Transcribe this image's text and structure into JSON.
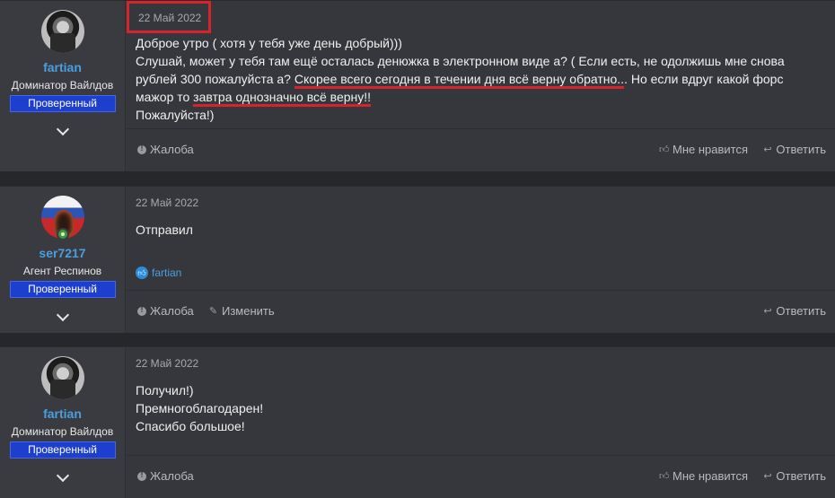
{
  "posts": [
    {
      "username": "fartian",
      "user_title": "Доминатор Вайлдов",
      "badge": "Проверенный",
      "avatar": "bw-portrait",
      "date": "22 Май 2022",
      "lines": {
        "l1": "Доброе утро ( хотя у тебя уже день добрый)))",
        "l2": "Слушай, может у тебя там ещё осталась денюжка в электронном виде а? ( Если есть, не одолжишь мне снова",
        "l3a": "рублей 300 пожалуйста а? ",
        "l3b": "Скорее всего сегодня в течении дня всё верну обратно..",
        "l3c": ". Но если вдруг какой форс",
        "l4a": "мажор то ",
        "l4b": "завтра однозначно всё верну!!",
        "l5": "Пожалуйста!)"
      },
      "actions": {
        "report": "Жалоба",
        "like": "Мне нравится",
        "reply": "Ответить"
      }
    },
    {
      "username": "ser7217",
      "user_title": "Агент Респинов",
      "badge": "Проверенный",
      "avatar": "flag-portrait",
      "date": "22 Май 2022",
      "lines": {
        "l1": "Отправил"
      },
      "liked_by": "fartian",
      "actions": {
        "report": "Жалоба",
        "edit": "Изменить",
        "reply": "Ответить"
      }
    },
    {
      "username": "fartian",
      "user_title": "Доминатор Вайлдов",
      "badge": "Проверенный",
      "avatar": "bw-portrait",
      "date": "22 Май 2022",
      "lines": {
        "l1": "Получил!)",
        "l2": "Премногоблагодарен!",
        "l3": "Спасибо большое!"
      },
      "actions": {
        "report": "Жалоба",
        "like": "Мне нравится",
        "reply": "Ответить"
      }
    }
  ],
  "colors": {
    "accent": "#4a9ee0",
    "badge": "#1d3fcf",
    "highlight": "#d6232c"
  }
}
